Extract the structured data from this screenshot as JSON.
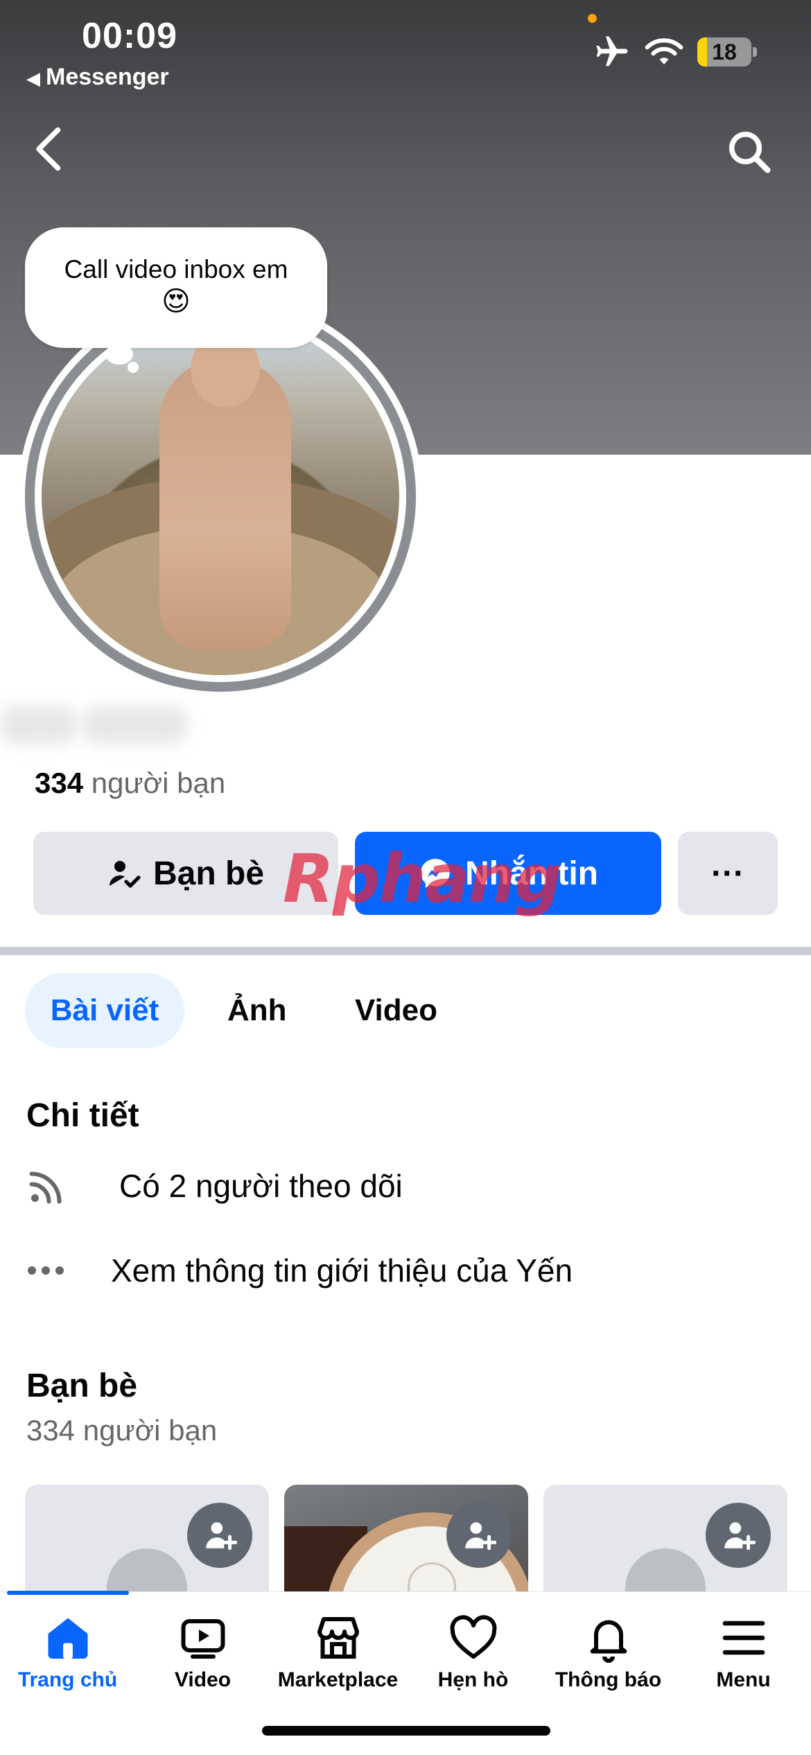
{
  "status_bar": {
    "time": "00:09",
    "back_app": "Messenger",
    "battery": "18",
    "battery_level": 0.18,
    "battery_color": "#ffd60a",
    "airplane_mode": true
  },
  "profile": {
    "note_text": "Call video inbox em",
    "note_emoji": "😍",
    "friends_count_number": "334",
    "friends_count_label": "người bạn"
  },
  "actions": {
    "friends_label": "Bạn bè",
    "message_label": "Nhắn tin",
    "more_label": "···"
  },
  "watermark": "Rphang",
  "tabs": [
    "Bài viết",
    "Ảnh",
    "Video"
  ],
  "details": {
    "title": "Chi tiết",
    "followers": "Có 2 người theo dõi",
    "about": "Xem thông tin giới thiệu của Yến"
  },
  "friends_section": {
    "title": "Bạn bè",
    "subtitle": "334 người bạn"
  },
  "bottom_nav": [
    {
      "label": "Trang chủ",
      "icon": "home-icon",
      "active": true
    },
    {
      "label": "Video",
      "icon": "video-icon",
      "active": false
    },
    {
      "label": "Marketplace",
      "icon": "marketplace-icon",
      "active": false
    },
    {
      "label": "Hẹn hò",
      "icon": "heart-icon",
      "active": false
    },
    {
      "label": "Thông báo",
      "icon": "bell-icon",
      "active": false
    },
    {
      "label": "Menu",
      "icon": "menu-icon",
      "active": false
    }
  ],
  "colors": {
    "accent": "#0866ff",
    "button_grey": "#e4e6eb",
    "text": "#050505",
    "muted": "#65676b"
  }
}
